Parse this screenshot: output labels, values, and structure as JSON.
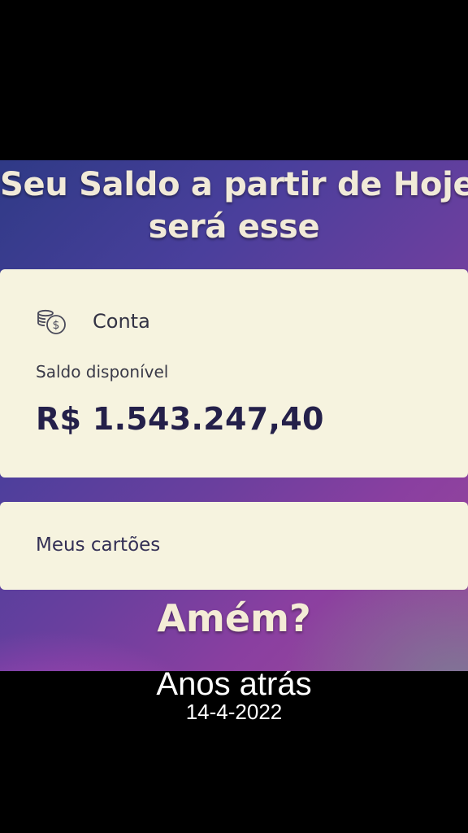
{
  "headline": {
    "line1": "Seu Saldo a partir de Hoje",
    "line2": "será esse"
  },
  "account": {
    "icon": "coin-dollar-icon",
    "label": "Conta",
    "balance_label": "Saldo disponível",
    "balance_value": "R$ 1.543.247,40"
  },
  "cards": {
    "label": "Meus cartões"
  },
  "overlay": {
    "amen": "Amém?"
  },
  "caption": {
    "title": "Anos atrás",
    "date": "14-4-2022"
  },
  "colors": {
    "background": "#000000",
    "card": "#f6f3df",
    "balance_text": "#24204a",
    "headline_text": "#f1ead8"
  }
}
